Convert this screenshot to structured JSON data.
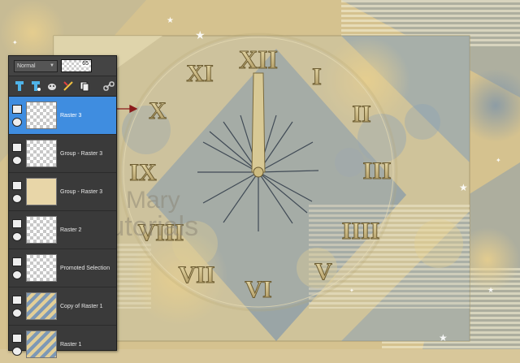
{
  "canvas": {
    "watermark_line1": "Mary",
    "watermark_line2": "Tutorials",
    "numerals": [
      "XII",
      "I",
      "II",
      "III",
      "IIII",
      "V",
      "VI",
      "VII",
      "VIII",
      "IX",
      "X",
      "XI"
    ]
  },
  "layers_panel": {
    "blend_mode": "Normal",
    "opacity": "65",
    "toolbar_icons": [
      "new-raster-layer-icon",
      "new-vector-layer-icon",
      "new-mask-layer-icon",
      "adjustment-layer-icon",
      "duplicate-layer-icon",
      "link-icon"
    ],
    "layers": [
      {
        "name": "Raster 3",
        "selected": true
      },
      {
        "name": "Group - Raster 3",
        "selected": false
      },
      {
        "name": "Group - Raster 3",
        "selected": false
      },
      {
        "name": "Raster 2",
        "selected": false
      },
      {
        "name": "Promoted Selection",
        "selected": false
      },
      {
        "name": "Copy of Raster 1",
        "selected": false
      },
      {
        "name": "Raster 1",
        "selected": false
      }
    ]
  },
  "colors": {
    "selected_row": "#3f8de0",
    "panel_bg": "#3a3a3a",
    "gold": "#c9b37a",
    "blue": "#5f7f9f",
    "arrow": "#8b1a1a"
  }
}
